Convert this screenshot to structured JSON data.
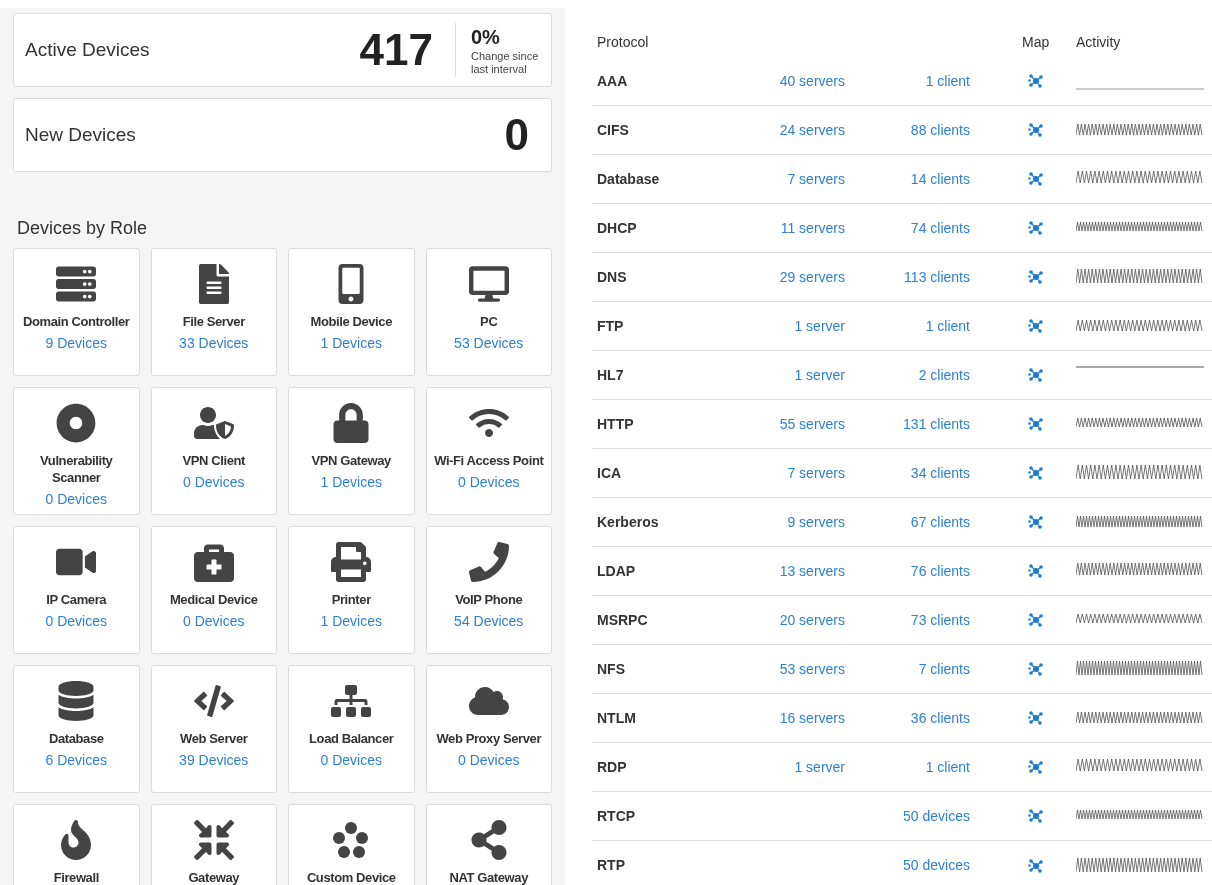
{
  "summary": [
    {
      "label": "Active Devices",
      "value": "417",
      "change": {
        "value": "0%",
        "caption": "Change since last interval"
      }
    },
    {
      "label": "New Devices",
      "value": "0"
    }
  ],
  "devices_by_role": {
    "title": "Devices by Role",
    "tiles": [
      {
        "name": "Domain Controller",
        "count": "9 Devices"
      },
      {
        "name": "File Server",
        "count": "33 Devices"
      },
      {
        "name": "Mobile Device",
        "count": "1 Devices"
      },
      {
        "name": "PC",
        "count": "53 Devices"
      },
      {
        "name": "Vulnerability Scanner",
        "count": "0 Devices"
      },
      {
        "name": "VPN Client",
        "count": "0 Devices"
      },
      {
        "name": "VPN Gateway",
        "count": "1 Devices"
      },
      {
        "name": "Wi-Fi Access Point",
        "count": "0 Devices"
      },
      {
        "name": "IP Camera",
        "count": "0 Devices"
      },
      {
        "name": "Medical Device",
        "count": "0 Devices"
      },
      {
        "name": "Printer",
        "count": "1 Devices"
      },
      {
        "name": "VoIP Phone",
        "count": "54 Devices"
      },
      {
        "name": "Database",
        "count": "6 Devices"
      },
      {
        "name": "Web Server",
        "count": "39 Devices"
      },
      {
        "name": "Load Balancer",
        "count": "0 Devices"
      },
      {
        "name": "Web Proxy Server",
        "count": "0 Devices"
      },
      {
        "name": "Firewall"
      },
      {
        "name": "Gateway"
      },
      {
        "name": "Custom Device"
      },
      {
        "name": "NAT Gateway"
      }
    ]
  },
  "protocols": {
    "columns": [
      "Protocol",
      "Map",
      "Activity"
    ],
    "rows": [
      {
        "protocol": "AAA",
        "column_2": "40 servers",
        "column_3": "1 client",
        "activity": {
          "kind": "baseline"
        }
      },
      {
        "protocol": "CIFS",
        "column_2": "24 servers",
        "column_3": "88 clients",
        "activity": {
          "kind": "wave"
        }
      },
      {
        "protocol": "Database",
        "column_2": "7 servers",
        "column_3": "14 clients",
        "activity": {
          "kind": "wave"
        }
      },
      {
        "protocol": "DHCP",
        "column_2": "11 servers",
        "column_3": "74 clients",
        "activity": {
          "kind": "wave"
        }
      },
      {
        "protocol": "DNS",
        "column_2": "29 servers",
        "column_3": "113 clients",
        "activity": {
          "kind": "wave"
        }
      },
      {
        "protocol": "FTP",
        "column_2": "1 server",
        "column_3": "1 client",
        "activity": {
          "kind": "wave"
        }
      },
      {
        "protocol": "HL7",
        "column_2": "1 server",
        "column_3": "2 clients",
        "activity": {
          "kind": "ceiling"
        }
      },
      {
        "protocol": "HTTP",
        "column_2": "55 servers",
        "column_3": "131 clients",
        "activity": {
          "kind": "wave"
        }
      },
      {
        "protocol": "ICA",
        "column_2": "7 servers",
        "column_3": "34 clients",
        "activity": {
          "kind": "wave"
        }
      },
      {
        "protocol": "Kerberos",
        "column_2": "9 servers",
        "column_3": "67 clients",
        "activity": {
          "kind": "wave"
        }
      },
      {
        "protocol": "LDAP",
        "column_2": "13 servers",
        "column_3": "76 clients",
        "activity": {
          "kind": "wave"
        }
      },
      {
        "protocol": "MSRPC",
        "column_2": "20 servers",
        "column_3": "73 clients",
        "activity": {
          "kind": "wave"
        }
      },
      {
        "protocol": "NFS",
        "column_2": "53 servers",
        "column_3": "7 clients",
        "activity": {
          "kind": "wave"
        }
      },
      {
        "protocol": "NTLM",
        "column_2": "16 servers",
        "column_3": "36 clients",
        "activity": {
          "kind": "wave"
        }
      },
      {
        "protocol": "RDP",
        "column_2": "1 server",
        "column_3": "1 client",
        "activity": {
          "kind": "wave"
        }
      },
      {
        "protocol": "RTCP",
        "column_3": "50 devices",
        "activity": {
          "kind": "wave"
        }
      },
      {
        "protocol": "RTP",
        "column_3": "50 devices",
        "activity": {
          "kind": "wave"
        }
      }
    ]
  }
}
